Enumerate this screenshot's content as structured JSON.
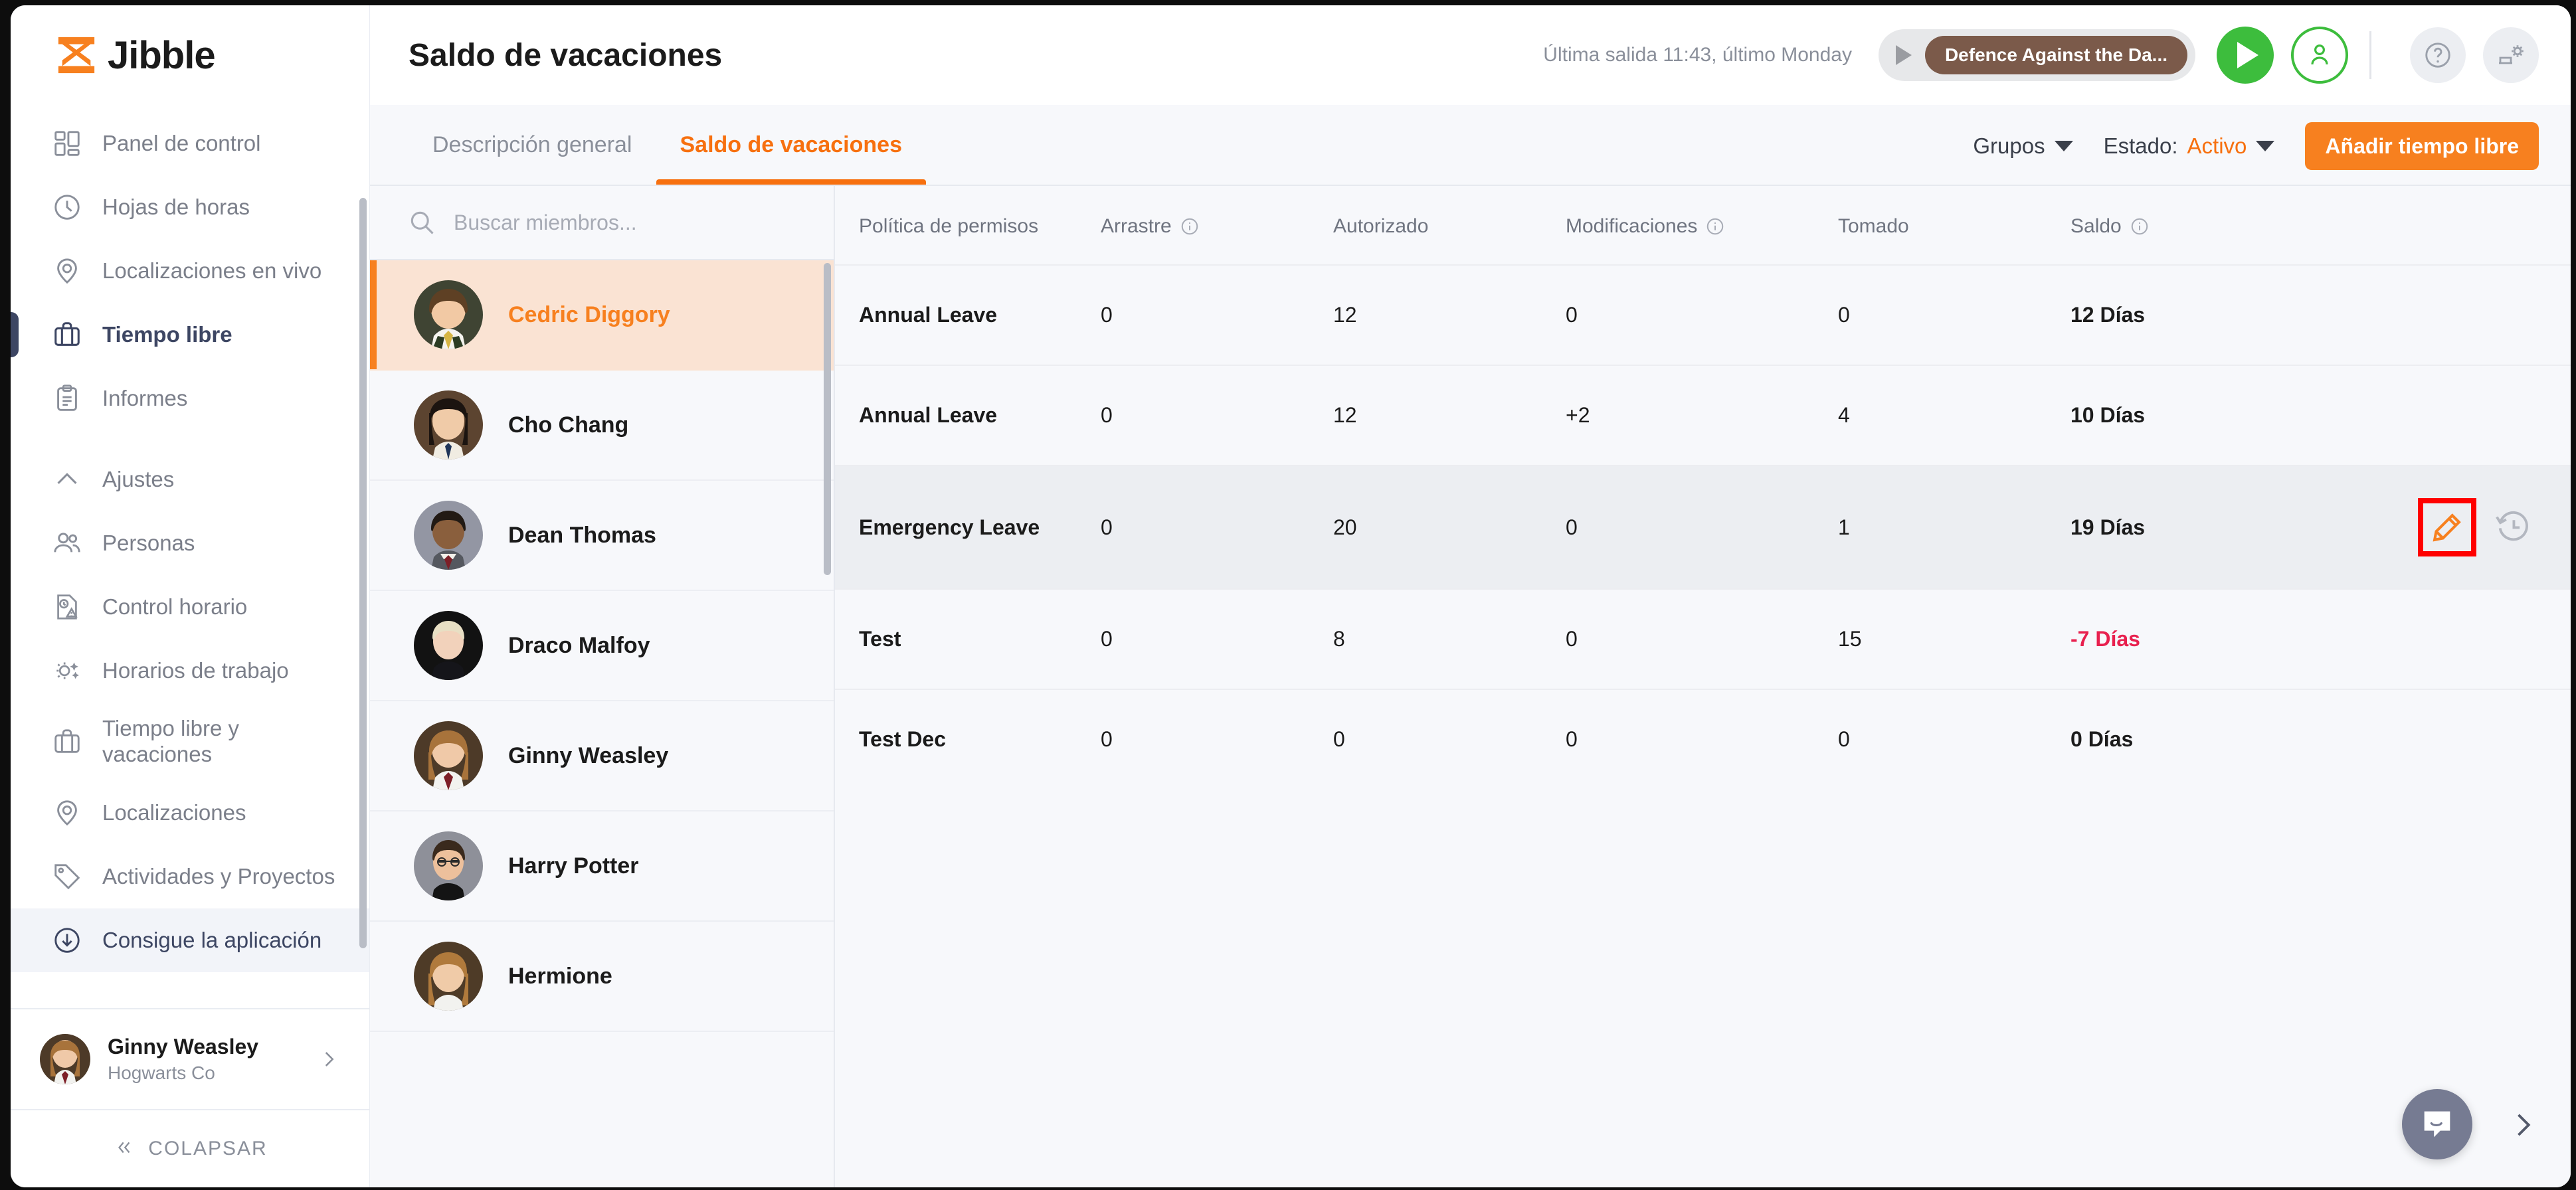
{
  "brand": {
    "name": "Jibble",
    "accent": "#f7801f",
    "highlight_outline": "#ff0000"
  },
  "sidebar": {
    "primary_items": [
      {
        "label": "Panel de control",
        "icon": "dashboard-icon",
        "active": false
      },
      {
        "label": "Hojas de horas",
        "icon": "clock-icon",
        "active": false
      },
      {
        "label": "Localizaciones en vivo",
        "icon": "pin-icon",
        "active": false
      },
      {
        "label": "Tiempo libre",
        "icon": "briefcase-icon",
        "active": true
      },
      {
        "label": "Informes",
        "icon": "clipboard-icon",
        "active": false
      }
    ],
    "settings_items": [
      {
        "label": "Ajustes",
        "icon": "chevron-up-icon",
        "active": false
      },
      {
        "label": "Personas",
        "icon": "people-icon",
        "active": false
      },
      {
        "label": "Control horario",
        "icon": "time-attendance-icon",
        "active": false
      },
      {
        "label": "Horarios de trabajo",
        "icon": "sun-moon-icon",
        "active": false
      },
      {
        "label": "Tiempo libre y vacaciones",
        "icon": "briefcase-icon",
        "active": false
      },
      {
        "label": "Localizaciones",
        "icon": "pin-icon",
        "active": false
      },
      {
        "label": "Actividades y Proyectos",
        "icon": "tag-icon",
        "active": false
      }
    ],
    "get_app": {
      "label": "Consigue la aplicación",
      "icon": "download-circle-icon"
    },
    "account": {
      "name": "Ginny Weasley",
      "org": "Hogwarts Co",
      "avatar": "avatar-ginny-weasley"
    },
    "collapse": {
      "label": "COLAPSAR",
      "icon": "double-chevron-left-icon"
    }
  },
  "header": {
    "title": "Saldo de vacaciones",
    "last_out": "Última salida 11:43, último Monday",
    "activity_chip": "Defence Against the Da...",
    "play_button": "play-button",
    "person_button": "person-clock-button",
    "help_button": "help-icon",
    "kiosk_button": "kiosk-settings-icon"
  },
  "tabs": [
    {
      "label": "Descripción general",
      "active": false
    },
    {
      "label": "Saldo de vacaciones",
      "active": true
    }
  ],
  "filters": {
    "groups_label": "Grupos",
    "status_label": "Estado:",
    "status_value": "Activo",
    "add_button": "Añadir tiempo libre"
  },
  "members": {
    "search_placeholder": "Buscar miembros...",
    "search_value": "",
    "list": [
      {
        "name": "Cedric Diggory",
        "selected": true
      },
      {
        "name": "Cho Chang",
        "selected": false
      },
      {
        "name": "Dean Thomas",
        "selected": false
      },
      {
        "name": "Draco Malfoy",
        "selected": false
      },
      {
        "name": "Ginny Weasley",
        "selected": false
      },
      {
        "name": "Harry Potter",
        "selected": false
      },
      {
        "name": "Hermione",
        "selected": false
      }
    ]
  },
  "table": {
    "columns": [
      {
        "label": "Política de permisos",
        "info": false
      },
      {
        "label": "Arrastre",
        "info": true
      },
      {
        "label": "Autorizado",
        "info": false
      },
      {
        "label": "Modificaciones",
        "info": true
      },
      {
        "label": "Tomado",
        "info": false
      },
      {
        "label": "Saldo",
        "info": true
      }
    ],
    "rows": [
      {
        "policy": "Annual Leave",
        "carryover": "0",
        "entitled": "12",
        "adjustments": "0",
        "taken": "0",
        "balance": "12 Días",
        "negative": false,
        "highlighted": false
      },
      {
        "policy": "Annual Leave",
        "carryover": "0",
        "entitled": "12",
        "adjustments": "+2",
        "taken": "4",
        "balance": "10 Días",
        "negative": false,
        "highlighted": false
      },
      {
        "policy": "Emergency Leave",
        "carryover": "0",
        "entitled": "20",
        "adjustments": "0",
        "taken": "1",
        "balance": "19 Días",
        "negative": false,
        "highlighted": true
      },
      {
        "policy": "Test",
        "carryover": "0",
        "entitled": "8",
        "adjustments": "0",
        "taken": "15",
        "balance": "-7 Días",
        "negative": true,
        "highlighted": false
      },
      {
        "policy": "Test Dec",
        "carryover": "0",
        "entitled": "0",
        "adjustments": "0",
        "taken": "0",
        "balance": "0 Días",
        "negative": false,
        "highlighted": false
      }
    ],
    "row_actions": {
      "edit": "edit-pencil-icon",
      "history": "history-clock-icon"
    }
  },
  "widgets": {
    "chat": "chat-bubble-icon",
    "next": "chevron-right-icon"
  }
}
